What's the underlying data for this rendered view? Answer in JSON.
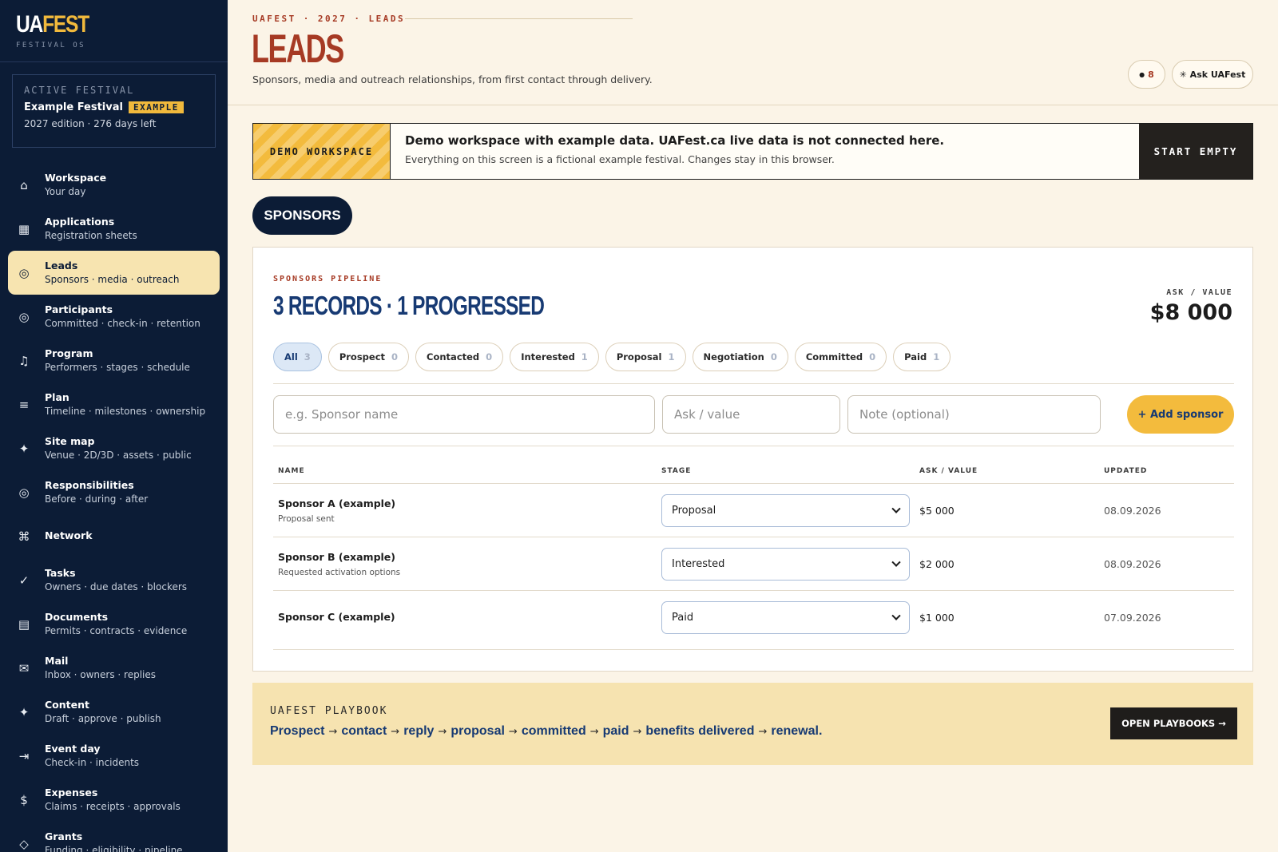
{
  "brand": {
    "ua": "UA",
    "fest": "FEST",
    "subtitle": "FESTIVAL OS"
  },
  "festival_card": {
    "label": "ACTIVE FESTIVAL",
    "name": "Example Festival",
    "badge": "EXAMPLE",
    "meta": "2027 edition · 276 days left"
  },
  "nav": [
    {
      "icon": "⌂",
      "icon_name": "home-icon",
      "title": "Workspace",
      "sub": "Your day"
    },
    {
      "icon": "▦",
      "icon_name": "grid-icon",
      "title": "Applications",
      "sub": "Registration sheets"
    },
    {
      "icon": "◎",
      "icon_name": "target-icon",
      "title": "Leads",
      "sub": "Sponsors · media · outreach",
      "active": true
    },
    {
      "icon": "◎",
      "icon_name": "target-icon",
      "title": "Participants",
      "sub": "Committed · check-in · retention"
    },
    {
      "icon": "♫",
      "icon_name": "music-icon",
      "title": "Program",
      "sub": "Performers · stages · schedule"
    },
    {
      "icon": "≡",
      "icon_name": "list-icon",
      "title": "Plan",
      "sub": "Timeline · milestones · ownership"
    },
    {
      "icon": "✦",
      "icon_name": "map-pin-icon",
      "title": "Site map",
      "sub": "Venue · 2D/3D · assets · public"
    },
    {
      "icon": "◎",
      "icon_name": "target-icon",
      "title": "Responsibilities",
      "sub": "Before · during · after"
    },
    {
      "icon": "⌘",
      "icon_name": "network-icon",
      "title": "Network",
      "sub": ""
    },
    {
      "icon": "✓",
      "icon_name": "check-icon",
      "title": "Tasks",
      "sub": "Owners · due dates · blockers"
    },
    {
      "icon": "▤",
      "icon_name": "document-icon",
      "title": "Documents",
      "sub": "Permits · contracts · evidence"
    },
    {
      "icon": "✉",
      "icon_name": "mail-icon",
      "title": "Mail",
      "sub": "Inbox · owners · replies"
    },
    {
      "icon": "✦",
      "icon_name": "sparkle-icon",
      "title": "Content",
      "sub": "Draft · approve · publish"
    },
    {
      "icon": "⇥",
      "icon_name": "arrow-in-icon",
      "title": "Event day",
      "sub": "Check-in · incidents"
    },
    {
      "icon": "$",
      "icon_name": "dollar-icon",
      "title": "Expenses",
      "sub": "Claims · receipts · approvals"
    },
    {
      "icon": "◇",
      "icon_name": "diamond-icon",
      "title": "Grants",
      "sub": "Funding · eligibility · pipeline"
    }
  ],
  "header": {
    "crumbs": [
      "UAFEST",
      "2027",
      "LEADS"
    ],
    "title": "LEADS",
    "description": "Sponsors, media and outreach relationships, from first contact through delivery.",
    "notif_dot": "●",
    "notif_count": "8",
    "ask_label": "✳ Ask UAFest"
  },
  "demo": {
    "tag": "DEMO WORKSPACE",
    "title": "Demo workspace with example data. UAFest.ca live data is not connected here.",
    "sub": "Everything on this screen is a fictional example festival. Changes stay in this browser.",
    "button": "START EMPTY"
  },
  "tab": "SPONSORS",
  "pipeline": {
    "kicker": "SPONSORS PIPELINE",
    "title": "3 RECORDS · 1 PROGRESSED",
    "kpi_label": "ASK / VALUE",
    "kpi_value": "$8 000",
    "filters": [
      {
        "label": "All",
        "count": "3",
        "active": true
      },
      {
        "label": "Prospect",
        "count": "0"
      },
      {
        "label": "Contacted",
        "count": "0"
      },
      {
        "label": "Interested",
        "count": "1"
      },
      {
        "label": "Proposal",
        "count": "1"
      },
      {
        "label": "Negotiation",
        "count": "0"
      },
      {
        "label": "Committed",
        "count": "0"
      },
      {
        "label": "Paid",
        "count": "1"
      }
    ],
    "form": {
      "name_placeholder": "e.g. Sponsor name",
      "value_placeholder": "Ask / value",
      "note_placeholder": "Note (optional)",
      "add_label": "+ Add sponsor"
    },
    "columns": [
      "NAME",
      "STAGE",
      "ASK / VALUE",
      "UPDATED"
    ],
    "rows": [
      {
        "name": "Sponsor A (example)",
        "note": "Proposal sent",
        "stage": "Proposal",
        "value": "$5 000",
        "updated": "08.09.2026"
      },
      {
        "name": "Sponsor B (example)",
        "note": "Requested activation options",
        "stage": "Interested",
        "value": "$2 000",
        "updated": "08.09.2026"
      },
      {
        "name": "Sponsor C (example)",
        "note": "",
        "stage": "Paid",
        "value": "$1 000",
        "updated": "07.09.2026"
      }
    ]
  },
  "playbook": {
    "label": "UAFEST PLAYBOOK",
    "steps": [
      "Prospect",
      "contact",
      "reply",
      "proposal",
      "committed",
      "paid",
      "benefits delivered",
      "renewal."
    ],
    "arrow": "→",
    "button": "OPEN PLAYBOOKS →"
  },
  "colors": {
    "sidebar": "#0c1c36",
    "accent_gold": "#f3bb3d",
    "title_red": "#a63a24",
    "navy_text": "#173a73",
    "page_bg": "#fbf4e7"
  }
}
